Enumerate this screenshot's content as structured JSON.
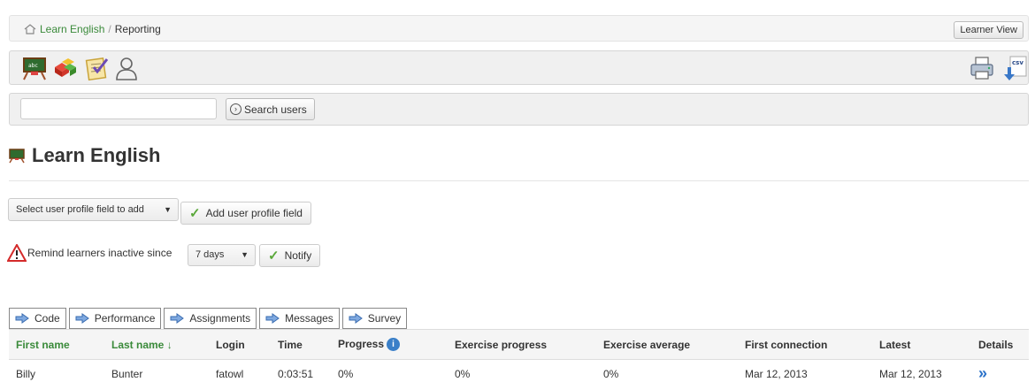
{
  "breadcrumb": {
    "home_link": "Learn English",
    "separator": "/",
    "current": "Reporting"
  },
  "header": {
    "learner_view_label": "Learner View"
  },
  "toolbar": {
    "left_icons": [
      "course-board-icon",
      "blocks-icon",
      "checklist-icon",
      "user-outline-icon"
    ],
    "right_icons": [
      "printer-icon",
      "csv-export-icon"
    ]
  },
  "search": {
    "input_value": "",
    "button_label": "Search users"
  },
  "course": {
    "title": "Learn English"
  },
  "profile_field": {
    "select_value": "Select user profile field to add",
    "add_label": "Add user profile field"
  },
  "remind": {
    "label": "Remind learners inactive since",
    "days_value": "7 days",
    "notify_label": "Notify"
  },
  "tabs": [
    {
      "label": "Code"
    },
    {
      "label": "Performance"
    },
    {
      "label": "Assignments"
    },
    {
      "label": "Messages"
    },
    {
      "label": "Survey"
    }
  ],
  "table": {
    "headers": {
      "first_name": "First name",
      "last_name": "Last name ↓",
      "login": "Login",
      "time": "Time",
      "progress": "Progress",
      "exercise_progress": "Exercise progress",
      "exercise_average": "Exercise average",
      "first_connection": "First connection",
      "latest": "Latest",
      "details": "Details"
    },
    "rows": [
      {
        "first_name": "Billy",
        "last_name": "Bunter",
        "login": "fatowl",
        "time": "0:03:51",
        "progress": "0%",
        "exercise_progress": "0%",
        "exercise_average": "0%",
        "first_connection": "Mar 12, 2013",
        "latest": "Mar 12, 2013",
        "details": "»"
      }
    ]
  },
  "colors": {
    "link_green": "#3a8a3a",
    "accent_blue": "#2b72c9",
    "bar_gray": "#f0f0f0"
  }
}
